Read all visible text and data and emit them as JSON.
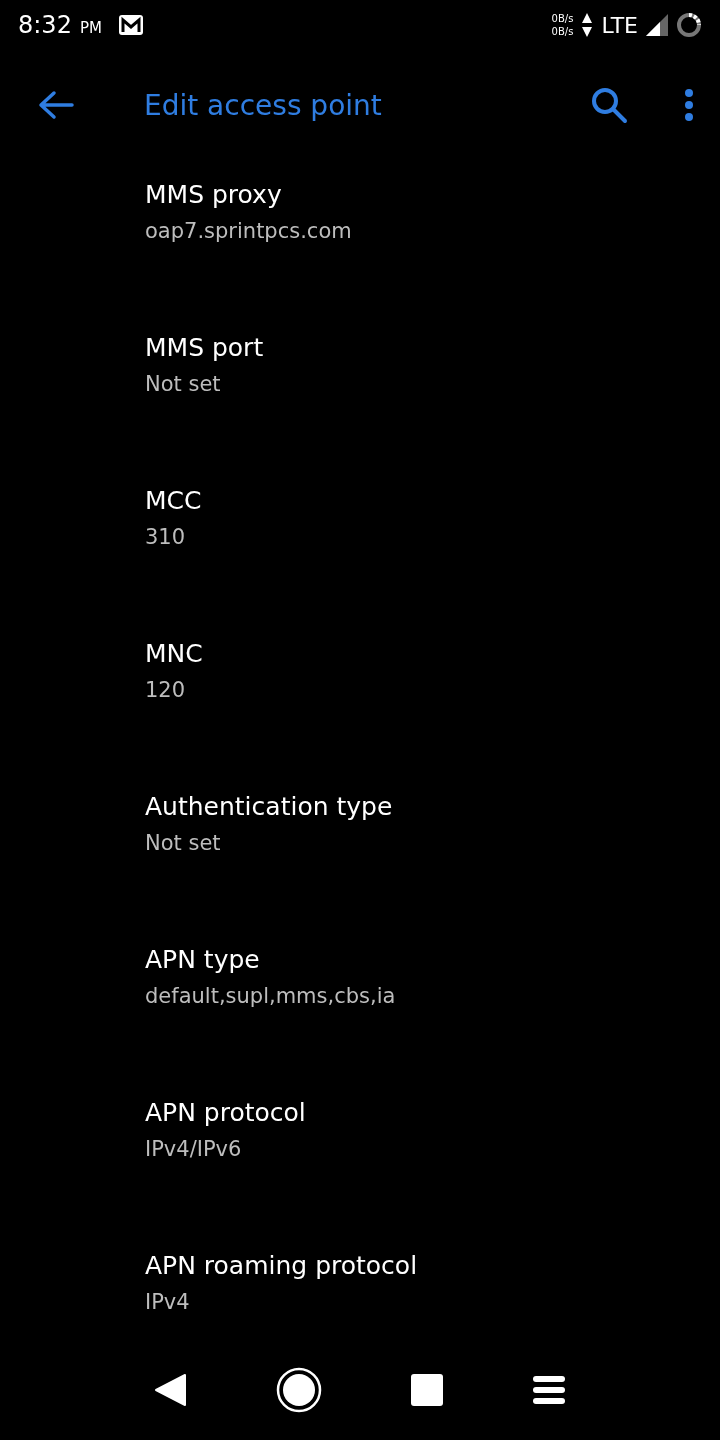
{
  "status_bar": {
    "time": "8:32",
    "ampm": "PM",
    "upload_speed": "0B/s",
    "download_speed": "0B/s",
    "network": "LTE"
  },
  "toolbar": {
    "title": "Edit access point"
  },
  "settings": [
    {
      "title": "MMS proxy",
      "value": "oap7.sprintpcs.com"
    },
    {
      "title": "MMS port",
      "value": "Not set"
    },
    {
      "title": "MCC",
      "value": "310"
    },
    {
      "title": "MNC",
      "value": "120"
    },
    {
      "title": "Authentication type",
      "value": "Not set"
    },
    {
      "title": "APN type",
      "value": "default,supl,mms,cbs,ia"
    },
    {
      "title": "APN protocol",
      "value": "IPv4/IPv6"
    },
    {
      "title": "APN roaming protocol",
      "value": "IPv4"
    }
  ]
}
